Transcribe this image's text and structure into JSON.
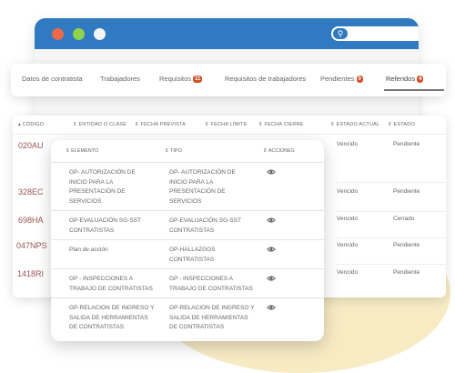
{
  "tabs": [
    {
      "label": "Datos de contratista"
    },
    {
      "label": "Trabajadores"
    },
    {
      "label": "Requisitos",
      "badge": "11"
    },
    {
      "label": "Requisitos de trabajadores"
    },
    {
      "label": "Pendientes",
      "badge": "0"
    },
    {
      "label": "Referidos",
      "badge": "4",
      "active": true
    }
  ],
  "table": {
    "headers": [
      "CÓDIGO",
      "ENTIDAD O CLASE",
      "FECHA PREVISTA",
      "FECHA LÍMITE",
      "FECHA CIERRE",
      "ESTADO ACTUAL",
      "ESTADO"
    ],
    "rows": [
      {
        "code": "020AU",
        "estado_actual": "Vencido",
        "estado": "Pendiente"
      },
      {
        "code": "328EC",
        "estado_actual": "Vencido",
        "estado": "Pendiente"
      },
      {
        "code": "698HA",
        "estado_actual": "Vencido",
        "estado": "Cerrado"
      },
      {
        "code": "047NPS",
        "estado_actual": "Vencido",
        "estado": "Pendiente"
      },
      {
        "code": "1418RI",
        "estado_actual": "Vencido",
        "estado": "Pendiente"
      }
    ]
  },
  "popup": {
    "headers": [
      "ELEMENTO",
      "TIPO",
      "ACCIONES"
    ],
    "rows": [
      {
        "elemento": [
          "GP- AUTORIZACIÓN DE",
          "INICIO PARA LA",
          "PRESENTACIÓN DE",
          "SERVICIOS"
        ],
        "tipo": [
          "GP- AUTORIZACIÓN DE",
          "INICIO PARA LA",
          "PRESENTACIÓN DE",
          "SERVICIOS"
        ]
      },
      {
        "elemento": [
          "GP-EVALUACIÓN SG-SST",
          "CONTRATISTAS"
        ],
        "tipo": [
          "GP-EVALUACIÓN SG-SST",
          "CONTRATISTAS"
        ]
      },
      {
        "elemento": [
          "Plan de acción"
        ],
        "tipo": [
          "GP-HALLAZGOS",
          "CONTRATISTAS"
        ]
      },
      {
        "elemento": [
          "GP - INSPECCIONES A",
          "TRABAJO DE CONTRATISTAS"
        ],
        "tipo": [
          "GP - INSPECCIONES A",
          "TRABAJO DE CONTRATISTAS"
        ]
      },
      {
        "elemento": [
          "GP-RELACION DE INGRESO Y",
          "SALIDA DE HERRAMIENTAS",
          "DE CONTRATISTAS"
        ],
        "tipo": [
          "GP-RELACION DE INGRESO Y",
          "SALIDA DE HERRAMIENTAS",
          "DE CONTRATISTAS"
        ]
      }
    ]
  },
  "icons": {
    "search": "search-icon",
    "mic": "mic-icon",
    "sort": "sort-icon",
    "view": "eye-icon"
  },
  "colors": {
    "browser_bar": "#2f7ac0",
    "badge": "#d2532b",
    "code_text": "#9a5454",
    "blob": "#f7ebc4"
  }
}
